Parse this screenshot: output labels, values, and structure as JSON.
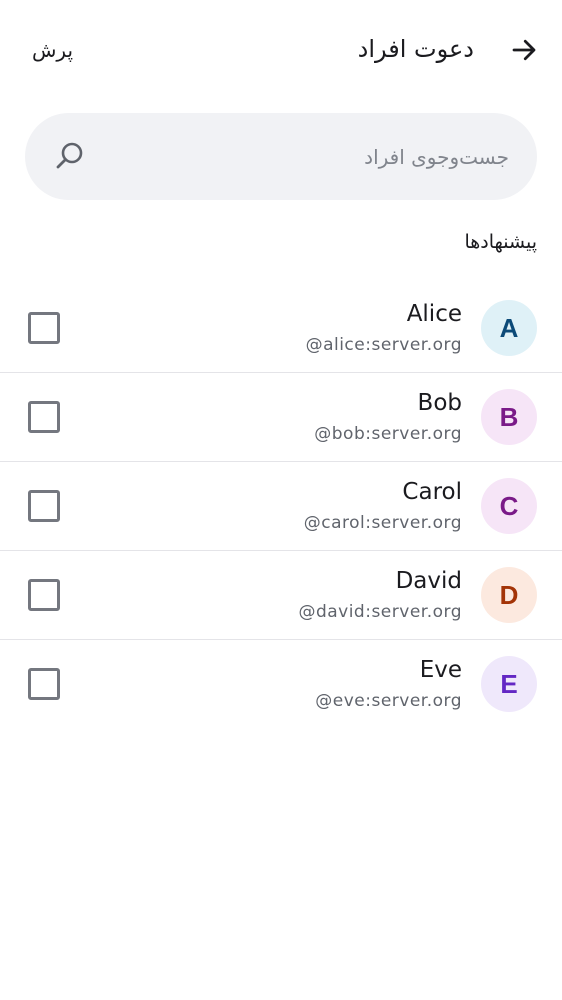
{
  "header": {
    "back_icon": "arrow-right-icon",
    "title": "دعوت افراد",
    "skip_label": "پرش"
  },
  "search": {
    "placeholder": "جست‌وجوی افراد",
    "icon": "search-icon"
  },
  "suggestions": {
    "title": "پیشنهادها",
    "items": [
      {
        "initial": "A",
        "name": "Alice",
        "id": "@alice:server.org",
        "avatar_bg": "#dff1f7",
        "avatar_fg": "#0c4a78",
        "checked": false
      },
      {
        "initial": "B",
        "name": "Bob",
        "id": "@bob:server.org",
        "avatar_bg": "#f6e5f7",
        "avatar_fg": "#7a1a88",
        "checked": false
      },
      {
        "initial": "C",
        "name": "Carol",
        "id": "@carol:server.org",
        "avatar_bg": "#f6e5f7",
        "avatar_fg": "#7a1a88",
        "checked": false
      },
      {
        "initial": "D",
        "name": "David",
        "id": "@david:server.org",
        "avatar_bg": "#fce9df",
        "avatar_fg": "#a33407",
        "checked": false
      },
      {
        "initial": "E",
        "name": "Eve",
        "id": "@eve:server.org",
        "avatar_bg": "#efe8fb",
        "avatar_fg": "#6327c4",
        "checked": false
      }
    ]
  }
}
